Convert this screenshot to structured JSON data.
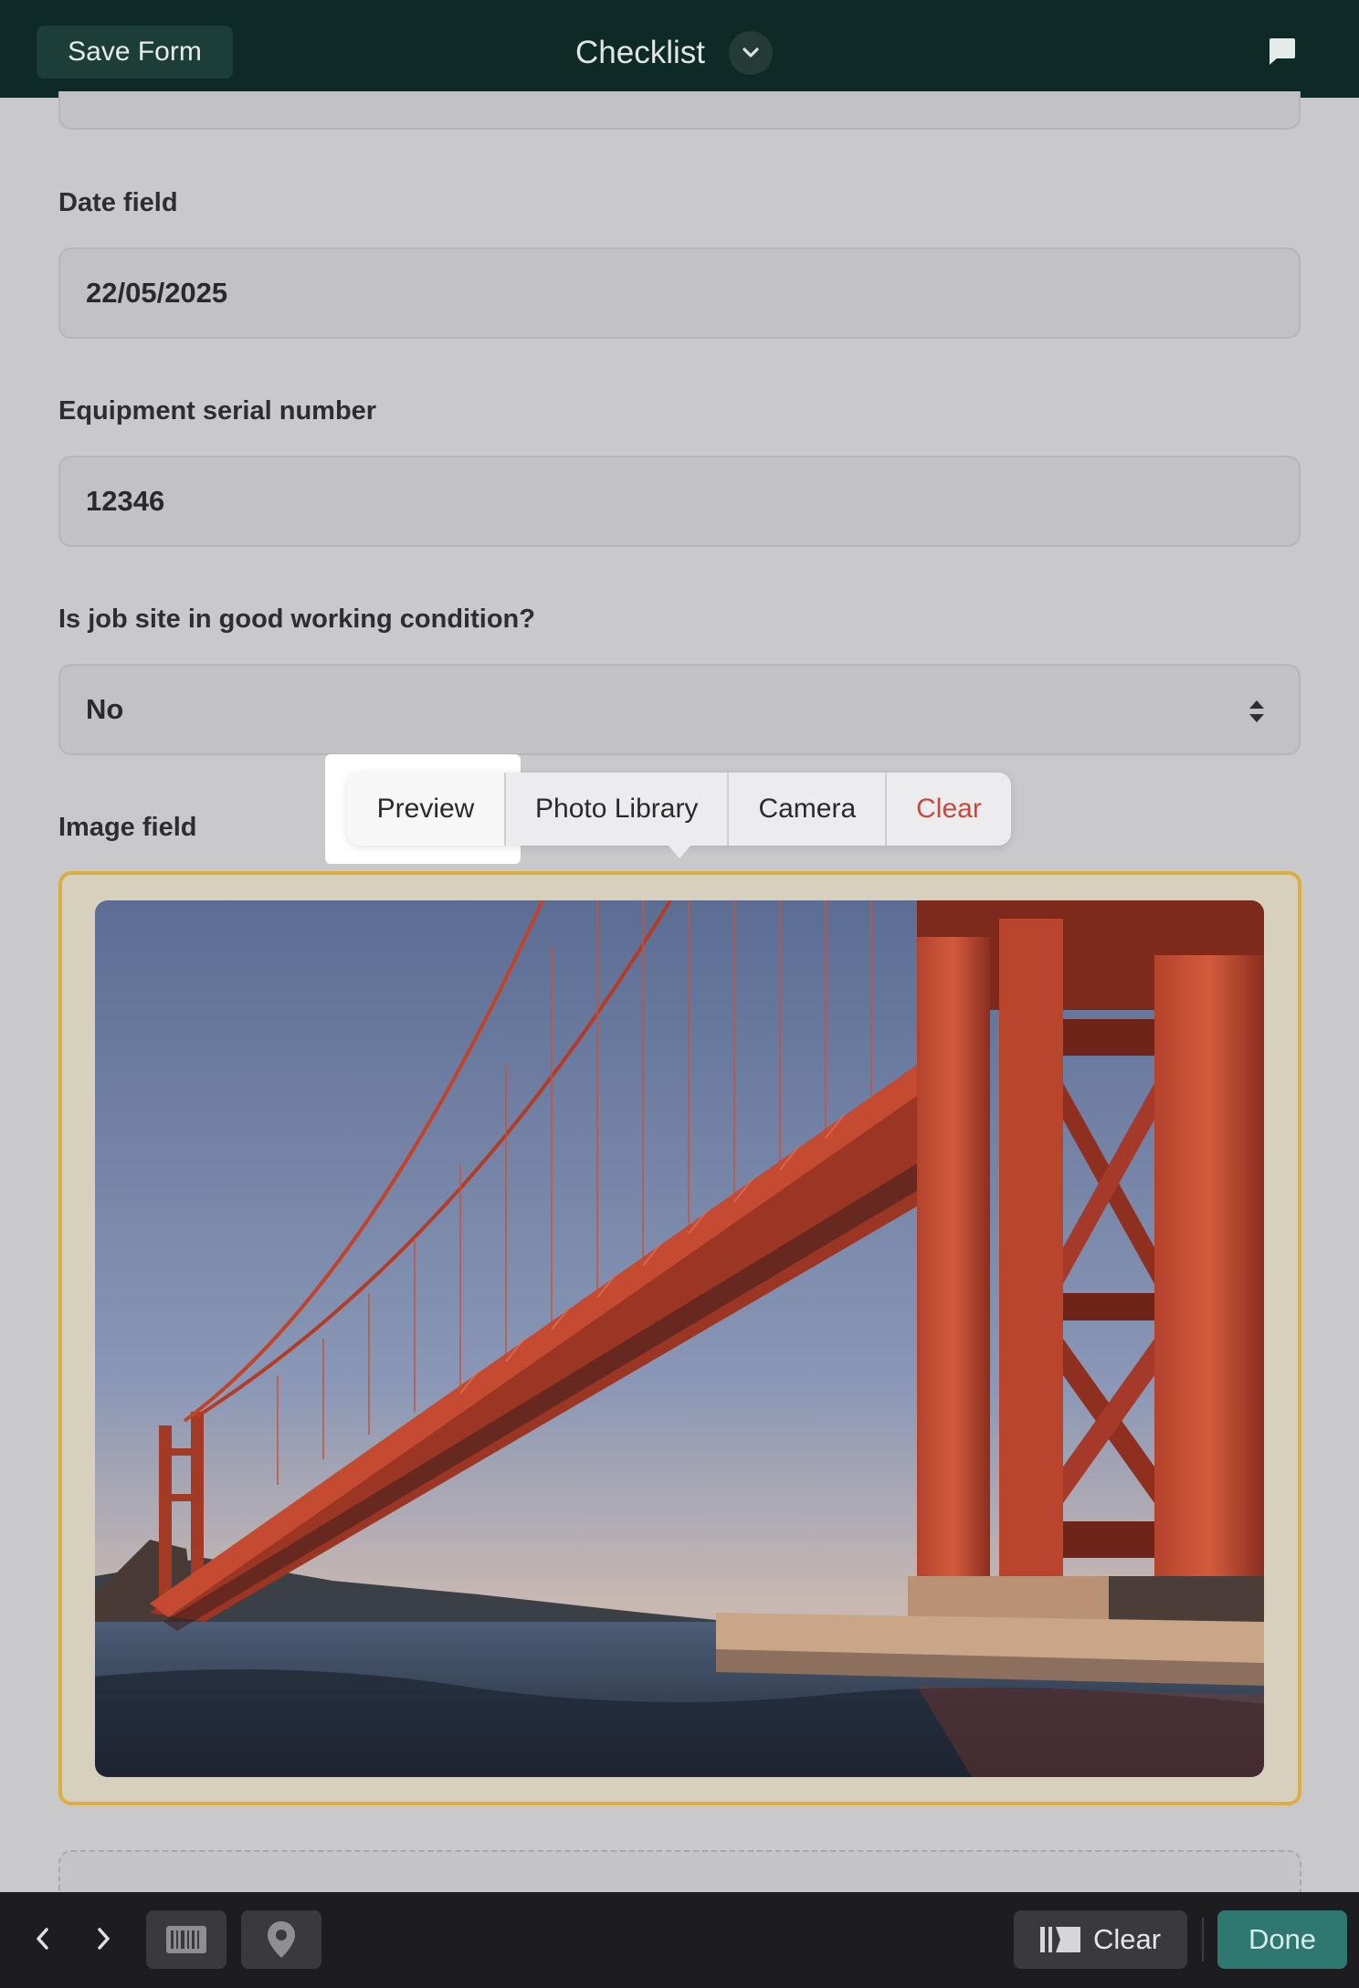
{
  "header": {
    "save_label": "Save Form",
    "title": "Checklist",
    "icons": {
      "dropdown": "chevron-down-icon",
      "comments": "chat-bubble-icon"
    }
  },
  "form": {
    "date_field": {
      "label": "Date field",
      "value": "22/05/2025"
    },
    "serial_field": {
      "label": "Equipment serial number",
      "value": "12346"
    },
    "condition_field": {
      "label": "Is job site in good working condition?",
      "value": "No"
    },
    "image_field": {
      "label": "Image field"
    }
  },
  "popover": {
    "items": [
      "Preview",
      "Photo Library",
      "Camera",
      "Clear"
    ],
    "destructive_color": "#c9473b"
  },
  "toolbar": {
    "clear_label": "Clear",
    "done_label": "Done",
    "icons": [
      "chevron-left-icon",
      "chevron-right-icon",
      "barcode-icon",
      "location-pin-icon",
      "eraser-icon"
    ]
  },
  "colors": {
    "header_bg": "#0e2a26",
    "accent_border": "#dcae42",
    "done_bg": "#2f7771"
  }
}
